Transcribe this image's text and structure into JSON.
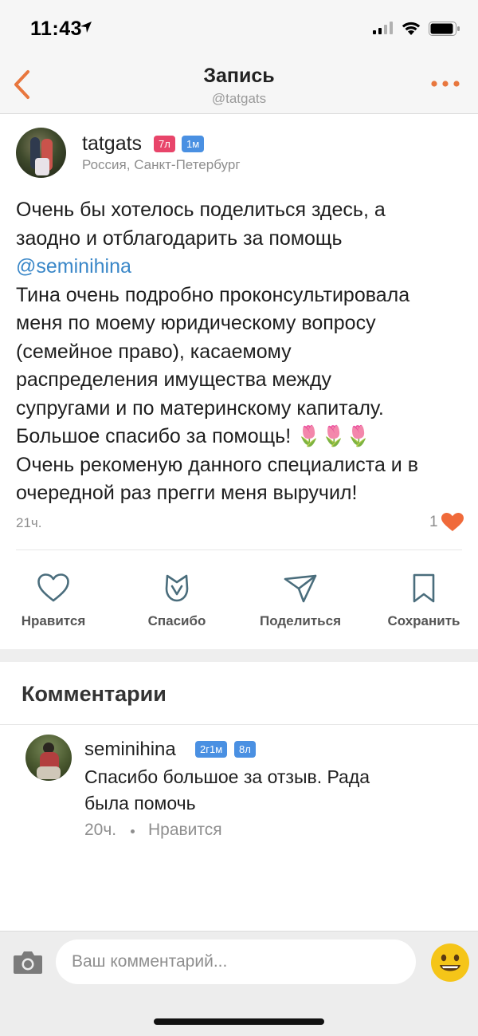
{
  "status_bar": {
    "time": "11:43"
  },
  "nav": {
    "title": "Запись",
    "subtitle": "@tatgats"
  },
  "post": {
    "username": "tatgats",
    "badges": [
      {
        "text": "7л",
        "color": "#e8456a"
      },
      {
        "text": "1м",
        "color": "#4a90e2"
      }
    ],
    "location": "Россия, Санкт-Петербург",
    "text_line1": "Очень бы хотелось поделиться здесь, а\nзаодно и отблагодарить за помощь\n",
    "mention": "@seminihina",
    "text_line2": "\nТина очень подробно проконсультировала\nменя по моему юридическому вопросу\n(семейное право), касаемому\nраспределения имущества между\nсупругами и по материнскому капиталу.\nБольшое спасибо за помощь! 🌷🌷🌷\nОчень рекоменую данного специалиста и в\nочередной раз прегги меня выручил!",
    "time": "21ч.",
    "like_count": "1"
  },
  "actions": {
    "like": "Нравится",
    "thanks": "Спасибо",
    "share": "Поделиться",
    "save": "Сохранить"
  },
  "comments": {
    "title": "Комментарии",
    "items": [
      {
        "username": "seminihina",
        "badges": [
          {
            "text": "2г1м",
            "color": "#4a90e2"
          },
          {
            "text": "8л",
            "color": "#4a90e2"
          }
        ],
        "text": "Спасибо большое за отзыв. Рада была помочь",
        "time": "20ч.",
        "like_label": "Нравится"
      }
    ]
  },
  "composer": {
    "placeholder": "Ваш комментарий..."
  },
  "colors": {
    "accent": "#e8773e",
    "link": "#3a87c8",
    "heart": "#f06a3a"
  }
}
